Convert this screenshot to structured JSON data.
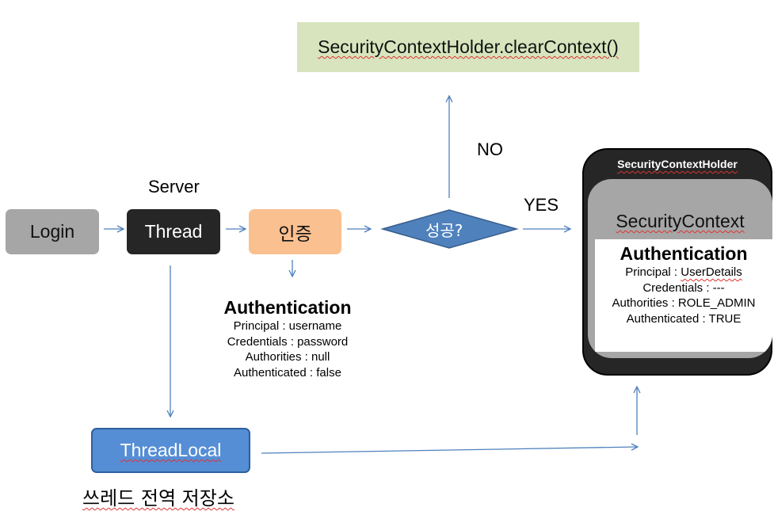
{
  "server_label": "Server",
  "nodes": {
    "login": "Login",
    "thread": "Thread",
    "auth": "인증",
    "decision": "성공?",
    "clear_context": "SecurityContextHolder.clearContext()",
    "threadlocal": "ThreadLocal",
    "threadlocal_caption": "쓰레드 전역 저장소"
  },
  "edges": {
    "no": "NO",
    "yes": "YES"
  },
  "auth_before": {
    "title": "Authentication",
    "lines": [
      "Principal : username",
      "Credentials : password",
      "Authorities : null",
      "Authenticated : false"
    ]
  },
  "holder": {
    "title": "SecurityContextHolder",
    "context_title": "SecurityContext",
    "auth_title": "Authentication",
    "principal_prefix": "Principal : ",
    "principal_value": "UserDetails",
    "lines": [
      "Credentials : ---",
      "Authorities : ROLE_ADMIN",
      "Authenticated : TRUE"
    ]
  },
  "colors": {
    "login": "#a6a6a6",
    "thread": "#262626",
    "auth": "#fac090",
    "decision": "#4f81bd",
    "clear_context": "#d7e4bd",
    "threadlocal": "#558ed5",
    "holder_outer": "#262626",
    "holder_inner": "#a6a6a6",
    "arrow": "#4f81bd"
  }
}
